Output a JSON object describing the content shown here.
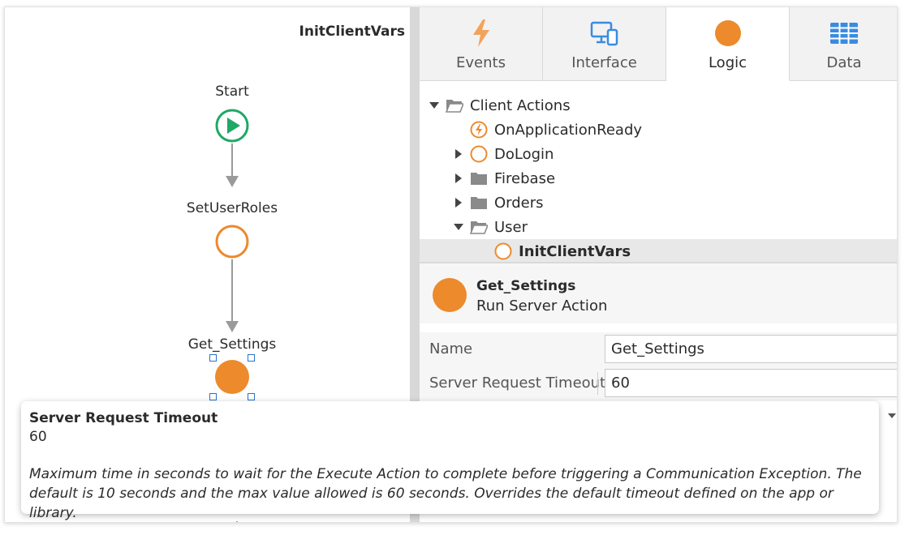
{
  "canvas": {
    "title": "InitClientVars",
    "nodes": [
      {
        "label": "Start",
        "kind": "start"
      },
      {
        "label": "SetUserRoles",
        "kind": "client-action"
      },
      {
        "label": "Get_Settings",
        "kind": "server-action",
        "selected": true
      }
    ]
  },
  "tabs": [
    {
      "label": "Events",
      "icon": "lightning-icon"
    },
    {
      "label": "Interface",
      "icon": "devices-icon"
    },
    {
      "label": "Logic",
      "icon": "logic-circle-icon",
      "active": true
    },
    {
      "label": "Data",
      "icon": "table-grid-icon"
    }
  ],
  "tree": {
    "items": [
      {
        "label": "Client Actions",
        "icon": "folder-open-icon",
        "caret": "expanded"
      },
      {
        "label": "OnApplicationReady",
        "icon": "event-action-icon",
        "caret": "none"
      },
      {
        "label": "DoLogin",
        "icon": "action-circle-icon",
        "caret": "collapsed"
      },
      {
        "label": "Firebase",
        "icon": "folder-icon",
        "caret": "collapsed"
      },
      {
        "label": "Orders",
        "icon": "folder-icon",
        "caret": "collapsed"
      },
      {
        "label": "User",
        "icon": "folder-open-icon",
        "caret": "expanded"
      },
      {
        "label": "InitClientVars",
        "icon": "action-circle-icon",
        "caret": "none",
        "selected": true
      }
    ]
  },
  "properties": {
    "title": "Get_Settings",
    "subtitle": "Run Server Action",
    "rows": [
      {
        "label": "Name",
        "value": "Get_Settings"
      },
      {
        "label": "Server Request Timeout",
        "value": "60"
      }
    ]
  },
  "tooltip": {
    "title": "Server Request Timeout",
    "value": "60",
    "description": "Maximum time in seconds to wait for the Execute Action to complete before triggering a Communication Exception. The default is 10 seconds and the max value allowed is 60 seconds. Overrides the default timeout defined on the app or library."
  },
  "colors": {
    "accent_orange": "#ec8a2c",
    "start_green": "#1fa866",
    "selection_blue": "#2a72c8"
  }
}
